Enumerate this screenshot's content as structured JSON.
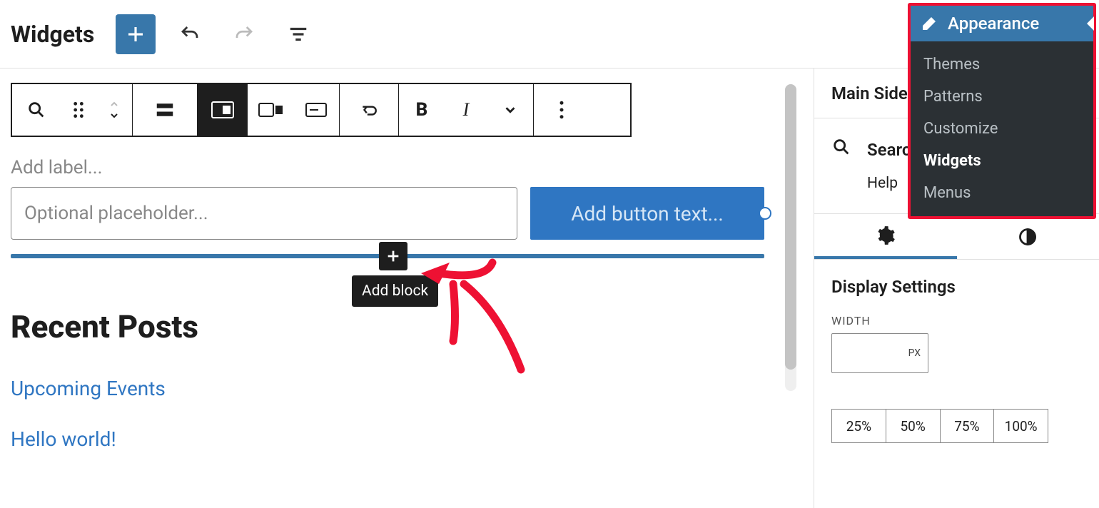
{
  "header": {
    "title": "Widgets"
  },
  "toolbar_groups": [
    [
      "search",
      "drag",
      "move"
    ],
    [
      "paragraph"
    ],
    [
      "align-left",
      "align-center",
      "align-right"
    ],
    [
      "loop"
    ],
    [
      "bold",
      "italic",
      "chevron"
    ],
    [
      "more"
    ]
  ],
  "editor": {
    "label_placeholder": "Add label...",
    "search_placeholder": "Optional placeholder...",
    "button_text_placeholder": "Add button text...",
    "add_block_tooltip": "Add block"
  },
  "recent": {
    "heading": "Recent Posts",
    "posts": [
      "Upcoming Events",
      "Hello world!"
    ]
  },
  "sidebar": {
    "title": "Main Sidebar",
    "search_label": "Search",
    "help_label": "Help",
    "display_settings": "Display Settings",
    "width_label": "WIDTH",
    "width_unit": "PX",
    "presets": [
      "25%",
      "50%",
      "75%",
      "100%"
    ]
  },
  "appearance_menu": {
    "title": "Appearance",
    "items": [
      "Themes",
      "Patterns",
      "Customize",
      "Widgets",
      "Menus"
    ],
    "active": "Widgets"
  }
}
